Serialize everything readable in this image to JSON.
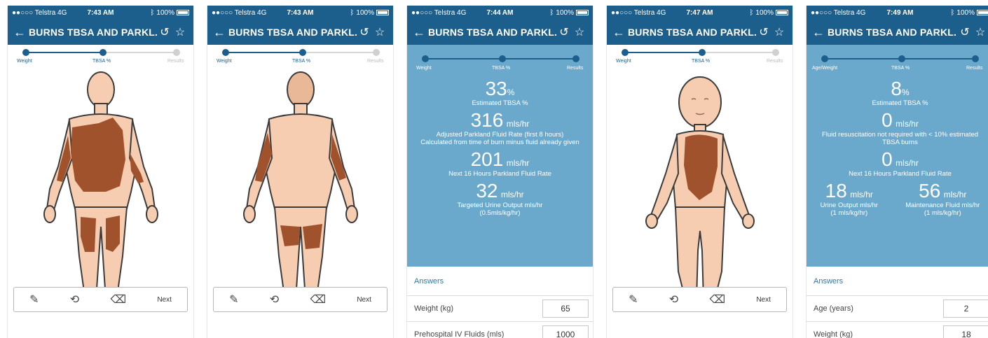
{
  "colors": {
    "header": "#1c5f8c",
    "results_bg": "#6aa9cc",
    "skin": "#f6cdb1",
    "burn": "#a0522d",
    "outline": "#3b3b3b"
  },
  "screens": [
    {
      "status": {
        "carrier": "●●○○○ Telstra  4G",
        "time": "7:43 AM",
        "battery": "100%"
      },
      "nav": {
        "title": "BURNS TBSA AND PARKL..."
      },
      "steps": [
        "Weight",
        "TBSA %",
        "Results"
      ],
      "toolbar": {
        "next": "Next"
      }
    },
    {
      "status": {
        "carrier": "●●○○○ Telstra  4G",
        "time": "7:43 AM",
        "battery": "100%"
      },
      "nav": {
        "title": "BURNS TBSA AND PARKL..."
      },
      "steps": [
        "Weight",
        "TBSA %",
        "Results"
      ],
      "toolbar": {
        "next": "Next"
      }
    },
    {
      "status": {
        "carrier": "●●○○○ Telstra  4G",
        "time": "7:44 AM",
        "battery": "100%"
      },
      "nav": {
        "title": "BURNS TBSA AND PARKL..."
      },
      "steps": [
        "Weight",
        "TBSA %",
        "Results"
      ],
      "results": [
        {
          "value": "33",
          "unit": "%",
          "desc": "Estimated TBSA %"
        },
        {
          "value": "316",
          "unit": "mls/hr",
          "desc": "Adjusted Parkland Fluid Rate (first 8 hours)",
          "desc2": "Calculated from time of burn minus fluid already given"
        },
        {
          "value": "201",
          "unit": "mls/hr",
          "desc": "Next 16 Hours Parkland Fluid Rate"
        },
        {
          "value": "32",
          "unit": "mls/hr",
          "desc": "Targeted Urine Output mls/hr",
          "desc2": "(0.5mls/kg/hr)"
        }
      ],
      "answers": {
        "header": "Answers",
        "rows": [
          {
            "label": "Weight (kg)",
            "value": "65"
          },
          {
            "label": "Prehospital IV Fluids (mls)",
            "value": "1000"
          }
        ]
      }
    },
    {
      "status": {
        "carrier": "●●○○○ Telstra  4G",
        "time": "7:47 AM",
        "battery": "100%"
      },
      "nav": {
        "title": "BURNS TBSA AND PARKL..."
      },
      "steps": [
        "Weight",
        "TBSA %",
        "Results"
      ],
      "toolbar": {
        "next": "Next"
      }
    },
    {
      "status": {
        "carrier": "●●○○○ Telstra  4G",
        "time": "7:49 AM",
        "battery": "100%"
      },
      "nav": {
        "title": "BURNS TBSA AND PARKL..."
      },
      "steps": [
        "Age/Weight",
        "TBSA %",
        "Results"
      ],
      "results": [
        {
          "value": "8",
          "unit": "%",
          "desc": "Estimated TBSA %"
        },
        {
          "value": "0",
          "unit": "mls/hr",
          "desc": "Fluid resuscitation not required with < 10% estimated TBSA burns"
        },
        {
          "value": "0",
          "unit": "mls/hr",
          "desc": "Next 16 Hours Parkland Fluid Rate"
        }
      ],
      "results_pair": [
        {
          "value": "18",
          "unit": "mls/hr",
          "desc": "Urine Output mls/hr",
          "desc2": "(1 mls/kg/hr)"
        },
        {
          "value": "56",
          "unit": "mls/hr",
          "desc": "Maintenance Fluid mls/hr",
          "desc2": "(1 mls/kg/hr)"
        }
      ],
      "answers": {
        "header": "Answers",
        "rows": [
          {
            "label": "Age (years)",
            "value": "2"
          },
          {
            "label": "Weight (kg)",
            "value": "18"
          }
        ]
      }
    }
  ]
}
